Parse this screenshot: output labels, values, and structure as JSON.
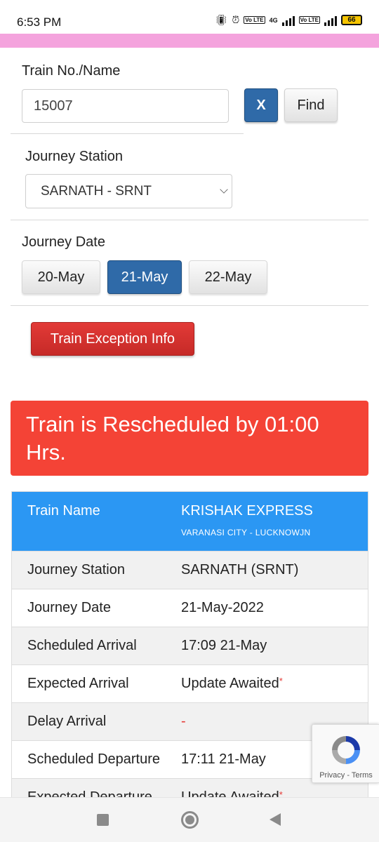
{
  "status_bar": {
    "time": "6:53 PM",
    "network": "4G",
    "lte": "Vo LTE",
    "battery": "66"
  },
  "search": {
    "train_label": "Train No./Name",
    "train_value": "15007",
    "clear_label": "X",
    "find_label": "Find"
  },
  "station": {
    "label": "Journey Station",
    "selected": "SARNATH - SRNT"
  },
  "date": {
    "label": "Journey Date",
    "options": [
      "20-May",
      "21-May",
      "22-May"
    ],
    "selected": "21-May"
  },
  "exception_button": "Train Exception Info",
  "alert": {
    "message": "Train is Rescheduled by 01:00 Hrs."
  },
  "details": {
    "header": {
      "key": "Train Name",
      "value": "KRISHAK EXPRESS",
      "route": "VARANASI CITY - LUCKNOWJN"
    },
    "rows": [
      {
        "key": "Journey Station",
        "value": "SARNATH (SRNT)"
      },
      {
        "key": "Journey Date",
        "value": "21-May-2022"
      },
      {
        "key": "Scheduled Arrival",
        "value": "17:09 21-May"
      },
      {
        "key": "Expected Arrival",
        "value": "Update Awaited",
        "mark": "*"
      },
      {
        "key": "Delay Arrival",
        "value": "-"
      },
      {
        "key": "Scheduled Departure",
        "value": "17:11 21-May"
      },
      {
        "key": "Expected Departure",
        "value": "Update Awaited",
        "mark": "*"
      }
    ]
  },
  "recaptcha": {
    "text": "Privacy - Terms"
  },
  "colors": {
    "primary_blue": "#2f6aa8",
    "header_blue": "#2b97f3",
    "alert_red": "#f44336",
    "button_red": "#d13330",
    "status_pink": "#f4a3dd"
  }
}
